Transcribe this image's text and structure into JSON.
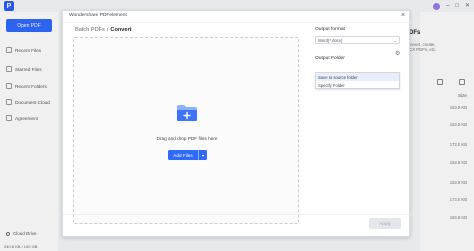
{
  "app": {
    "sidebar": {
      "open_button": "Open PDF",
      "items": [
        {
          "label": "Recent Files",
          "icon": "clock-icon"
        },
        {
          "label": "Starred Files",
          "icon": "star-icon"
        },
        {
          "label": "Recent Folders",
          "icon": "folder-icon"
        },
        {
          "label": "Document Cloud",
          "icon": "cloud-icon"
        },
        {
          "label": "Agreement",
          "icon": "document-icon"
        }
      ],
      "cloud_drive": "Cloud Drive",
      "storage": "240.6 KB / 100 GB"
    },
    "right_panel": {
      "title": "PDFs",
      "desc_lines": [
        "convert, create,",
        "DCX PDFs, etc."
      ],
      "size_header": "Size",
      "sizes": [
        "153.8 KB",
        "153.8 KB",
        "173.0 KB",
        "153.8 KB",
        "153.8 KB",
        "173.0 KB",
        "153.8 KB"
      ]
    }
  },
  "modal": {
    "title": "Wondershare PDFelement",
    "breadcrumb": {
      "parent": "Batch PDFs",
      "separator": "/",
      "current": "Convert"
    },
    "drop_text": "Drag and drop PDF files here",
    "add_files_label": "Add Files",
    "output_format": {
      "label": "Output format",
      "value": "Word(*.docx)"
    },
    "output_folder": {
      "label": "Output Folder",
      "value": "Save to source folder",
      "options": [
        "Save to source folder",
        "Specify Folder"
      ]
    },
    "apply_label": "Apply"
  }
}
